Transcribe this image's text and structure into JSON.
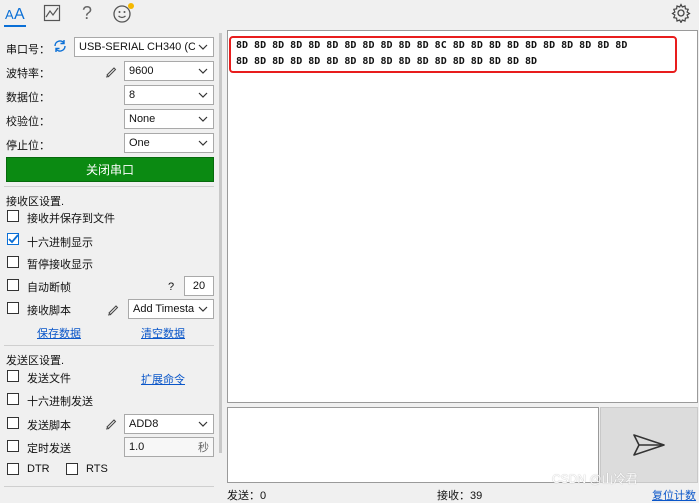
{
  "toolbar": {
    "icons": [
      "font-icon",
      "chart-icon",
      "help-icon",
      "smiley-icon",
      "gear-icon"
    ],
    "help_glyph": "?"
  },
  "serial": {
    "port_label": "串口号：",
    "port_value": "USB-SERIAL CH340 (COM",
    "baud_label": "波特率：",
    "baud_value": "9600",
    "databits_label": "数据位：",
    "databits_value": "8",
    "parity_label": "校验位：",
    "parity_value": "None",
    "stopbits_label": "停止位：",
    "stopbits_value": "One",
    "close_button": "关闭串口"
  },
  "receive_settings": {
    "title": "接收区设置.",
    "save_to_file": {
      "label": "接收并保存到文件",
      "checked": false
    },
    "hex_display": {
      "label": "十六进制显示",
      "checked": true
    },
    "pause_display": {
      "label": "暂停接收显示",
      "checked": false
    },
    "auto_frame": {
      "label": "自动断帧",
      "checked": false,
      "help": "?",
      "value": "20"
    },
    "recv_script": {
      "label": "接收脚本",
      "checked": false,
      "value": "Add Timesta"
    },
    "save_data_link": "保存数据",
    "clear_data_link": "清空数据"
  },
  "send_settings": {
    "title": "发送区设置.",
    "send_file": {
      "label": "发送文件",
      "checked": false
    },
    "expand_cmd_link": "扩展命令",
    "hex_send": {
      "label": "十六进制发送",
      "checked": false
    },
    "send_script": {
      "label": "发送脚本",
      "checked": false,
      "value": "ADD8"
    },
    "timed_send": {
      "label": "定时发送",
      "checked": false,
      "value": "1.0",
      "unit": "秒"
    },
    "dtr": {
      "label": "DTR",
      "checked": false
    },
    "rts": {
      "label": "RTS",
      "checked": false
    }
  },
  "receive_area": {
    "line1": "8D 8D 8D 8D 8D 8D 8D 8D 8D 8D 8D 8C 8D 8D 8D 8D 8D 8D 8D 8D 8D 8D",
    "line2": "8D 8D 8D 8D 8D 8D 8D 8D 8D 8D 8D 8D 8D 8D 8D 8D 8D"
  },
  "status_bar": {
    "sent_label": "发送：0",
    "recv_label": "接收：39",
    "reset_link": "复位计数"
  },
  "watermark": "CSDN @山冷君",
  "colors": {
    "accent": "#0a6fd6",
    "close_button_bg": "#0b8a12",
    "highlight_border": "#e81d1d",
    "link": "#0a56c9"
  }
}
